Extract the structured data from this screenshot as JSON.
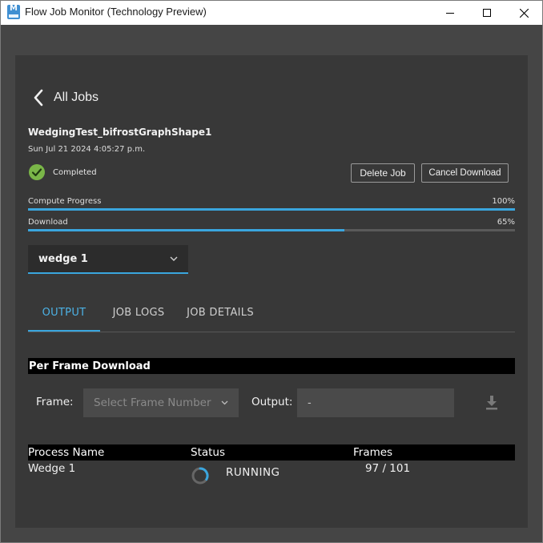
{
  "window": {
    "title": "Flow Job Monitor (Technology Preview)",
    "app_icon": "maya-icon"
  },
  "nav": {
    "back_label": "All Jobs"
  },
  "job": {
    "name": "WedgingTest_bifrostGraphShape1",
    "date": "Sun Jul 21 2024 4:05:27 p.m.",
    "status": "Completed"
  },
  "actions": {
    "delete_label": "Delete Job",
    "cancel_download_label": "Cancel Download"
  },
  "progress": {
    "compute": {
      "label": "Compute Progress",
      "percent_text": "100%",
      "value": 1.0
    },
    "download": {
      "label": "Download",
      "percent_text": "65%",
      "value": 0.65
    }
  },
  "wedge_select": {
    "selected": "wedge 1"
  },
  "tabs": [
    {
      "label": "OUTPUT",
      "active": true
    },
    {
      "label": "JOB LOGS",
      "active": false
    },
    {
      "label": "JOB DETAILS",
      "active": false
    }
  ],
  "per_frame": {
    "header": "Per Frame Download",
    "frame_label": "Frame:",
    "frame_placeholder": "Select Frame Number",
    "output_label": "Output:",
    "output_value": "-"
  },
  "processes": {
    "columns": [
      "Process Name",
      "Status",
      "Frames"
    ],
    "rows": [
      {
        "name": "Wedge 1",
        "status": "RUNNING",
        "frames": "97 / 101"
      }
    ]
  },
  "colors": {
    "accent": "#3aa6de",
    "panel_bg": "#383838",
    "window_bg": "#454545",
    "success": "#7ab648"
  }
}
